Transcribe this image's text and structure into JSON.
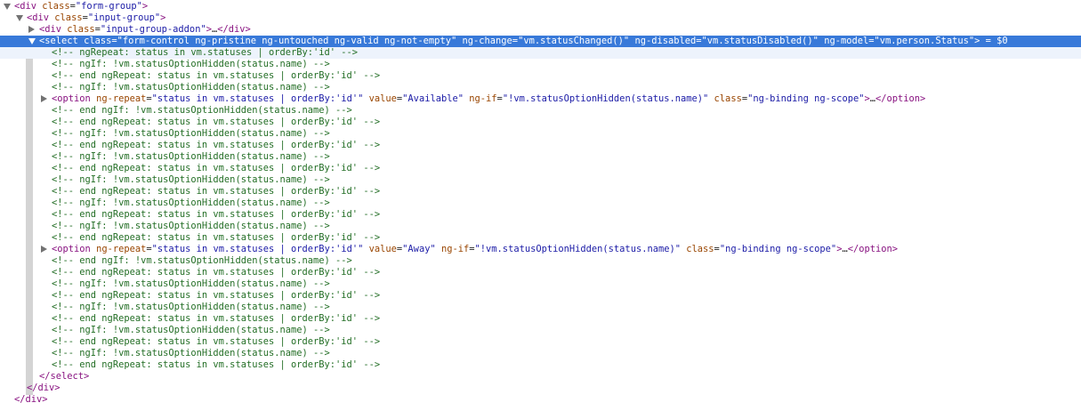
{
  "rows": [
    {
      "indent": 0,
      "toggle": "down",
      "html": "<span class=\"tag\">&lt;div</span> <span class=\"attr\">class</span><span class=\"eq\">=</span><span class=\"val\">\"form-group\"</span><span class=\"tag\">&gt;</span>"
    },
    {
      "indent": 1,
      "toggle": "down",
      "html": "<span class=\"tag\">&lt;div</span> <span class=\"attr\">class</span><span class=\"eq\">=</span><span class=\"val\">\"input-group\"</span><span class=\"tag\">&gt;</span>"
    },
    {
      "indent": 2,
      "toggle": "right",
      "html": "<span class=\"tag\">&lt;div</span> <span class=\"attr\">class</span><span class=\"eq\">=</span><span class=\"val\">\"input-group-addon\"</span><span class=\"tag\">&gt;</span>…<span class=\"tag\">&lt;/div&gt;</span>"
    },
    {
      "indent": 2,
      "toggle": "down",
      "selected": true,
      "html": "<span class=\"tag\">&lt;select</span> <span class=\"attr\">class</span><span class=\"eq\">=</span><span class=\"val\">\"form-control ng-pristine ng-untouched ng-valid ng-not-empty\"</span> <span class=\"attr\">ng-change</span><span class=\"eq\">=</span><span class=\"val\">\"vm.statusChanged()\"</span> <span class=\"attr\">ng-disabled</span><span class=\"eq\">=</span><span class=\"val\">\"vm.statusDisabled()\"</span> <span class=\"attr\">ng-model</span><span class=\"eq\">=</span><span class=\"val\">\"vm.person.Status\"</span><span class=\"tag\">&gt;</span><span class=\"sel\"> = $0</span>"
    },
    {
      "indent": 3,
      "child": true,
      "comment": "<!-- ngRepeat: status in vm.statuses | orderBy:'id' -->"
    },
    {
      "indent": 3,
      "comment": "<!-- ngIf: !vm.statusOptionHidden(status.name) -->"
    },
    {
      "indent": 3,
      "comment": "<!-- end ngRepeat: status in vm.statuses | orderBy:'id' -->"
    },
    {
      "indent": 3,
      "comment": "<!-- ngIf: !vm.statusOptionHidden(status.name) -->"
    },
    {
      "indent": 3,
      "toggle": "right",
      "html": "<span class=\"tag\">&lt;option</span> <span class=\"attr\">ng-repeat</span><span class=\"eq\">=</span><span class=\"val\">\"status in vm.statuses | orderBy:'id'\"</span> <span class=\"attr\">value</span><span class=\"eq\">=</span><span class=\"val\">\"Available\"</span> <span class=\"attr\">ng-if</span><span class=\"eq\">=</span><span class=\"val\">\"!vm.statusOptionHidden(status.name)\"</span> <span class=\"attr\">class</span><span class=\"eq\">=</span><span class=\"val\">\"ng-binding ng-scope\"</span><span class=\"tag\">&gt;</span>…<span class=\"tag\">&lt;/option&gt;</span>"
    },
    {
      "indent": 3,
      "comment": "<!-- end ngIf: !vm.statusOptionHidden(status.name) -->"
    },
    {
      "indent": 3,
      "comment": "<!-- end ngRepeat: status in vm.statuses | orderBy:'id' -->"
    },
    {
      "indent": 3,
      "comment": "<!-- ngIf: !vm.statusOptionHidden(status.name) -->"
    },
    {
      "indent": 3,
      "comment": "<!-- end ngRepeat: status in vm.statuses | orderBy:'id' -->"
    },
    {
      "indent": 3,
      "comment": "<!-- ngIf: !vm.statusOptionHidden(status.name) -->"
    },
    {
      "indent": 3,
      "comment": "<!-- end ngRepeat: status in vm.statuses | orderBy:'id' -->"
    },
    {
      "indent": 3,
      "comment": "<!-- ngIf: !vm.statusOptionHidden(status.name) -->"
    },
    {
      "indent": 3,
      "comment": "<!-- end ngRepeat: status in vm.statuses | orderBy:'id' -->"
    },
    {
      "indent": 3,
      "comment": "<!-- ngIf: !vm.statusOptionHidden(status.name) -->"
    },
    {
      "indent": 3,
      "comment": "<!-- end ngRepeat: status in vm.statuses | orderBy:'id' -->"
    },
    {
      "indent": 3,
      "comment": "<!-- ngIf: !vm.statusOptionHidden(status.name) -->"
    },
    {
      "indent": 3,
      "comment": "<!-- end ngRepeat: status in vm.statuses | orderBy:'id' -->"
    },
    {
      "indent": 3,
      "toggle": "right",
      "html": "<span class=\"tag\">&lt;option</span> <span class=\"attr\">ng-repeat</span><span class=\"eq\">=</span><span class=\"val\">\"status in vm.statuses | orderBy:'id'\"</span> <span class=\"attr\">value</span><span class=\"eq\">=</span><span class=\"val\">\"Away\"</span> <span class=\"attr\">ng-if</span><span class=\"eq\">=</span><span class=\"val\">\"!vm.statusOptionHidden(status.name)\"</span> <span class=\"attr\">class</span><span class=\"eq\">=</span><span class=\"val\">\"ng-binding ng-scope\"</span><span class=\"tag\">&gt;</span>…<span class=\"tag\">&lt;/option&gt;</span>"
    },
    {
      "indent": 3,
      "comment": "<!-- end ngIf: !vm.statusOptionHidden(status.name) -->"
    },
    {
      "indent": 3,
      "comment": "<!-- end ngRepeat: status in vm.statuses | orderBy:'id' -->"
    },
    {
      "indent": 3,
      "comment": "<!-- ngIf: !vm.statusOptionHidden(status.name) -->"
    },
    {
      "indent": 3,
      "comment": "<!-- end ngRepeat: status in vm.statuses | orderBy:'id' -->"
    },
    {
      "indent": 3,
      "comment": "<!-- ngIf: !vm.statusOptionHidden(status.name) -->"
    },
    {
      "indent": 3,
      "comment": "<!-- end ngRepeat: status in vm.statuses | orderBy:'id' -->"
    },
    {
      "indent": 3,
      "comment": "<!-- ngIf: !vm.statusOptionHidden(status.name) -->"
    },
    {
      "indent": 3,
      "comment": "<!-- end ngRepeat: status in vm.statuses | orderBy:'id' -->"
    },
    {
      "indent": 3,
      "comment": "<!-- ngIf: !vm.statusOptionHidden(status.name) -->"
    },
    {
      "indent": 3,
      "comment": "<!-- end ngRepeat: status in vm.statuses | orderBy:'id' -->"
    },
    {
      "indent": 2,
      "html": "<span class=\"tag\">&lt;/select&gt;</span>"
    },
    {
      "indent": 1,
      "html": "<span class=\"tag\">&lt;/div&gt;</span>"
    },
    {
      "indent": 0,
      "html": "<span class=\"tag\">&lt;/div&gt;</span>"
    }
  ],
  "colors": {
    "selection": "#3879d9",
    "tag": "#881280",
    "attribute": "#994500",
    "value": "#1a1aa6",
    "comment": "#236e25"
  }
}
